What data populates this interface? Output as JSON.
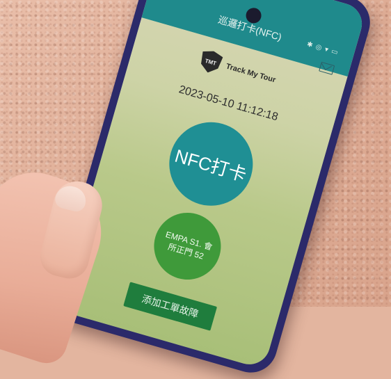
{
  "app": {
    "title": "巡邏打卡(NFC)",
    "status_icons": "✱ ◎ ▾ ▭",
    "brand": {
      "logo_text": "TMT",
      "name": "Track My Tour"
    },
    "datetime": "2023-05-10 11:12:18",
    "nfc_button_label": "NFC打卡",
    "location": {
      "line1": "EMPA S1. 會",
      "line2": "所正門 52"
    },
    "add_button_label": "添加工單故障"
  },
  "colors": {
    "topbar": "#1f8a8c",
    "nfc_circle": "#1f8f94",
    "location_circle": "#3f9a3a",
    "add_button": "#1f7d3d"
  }
}
